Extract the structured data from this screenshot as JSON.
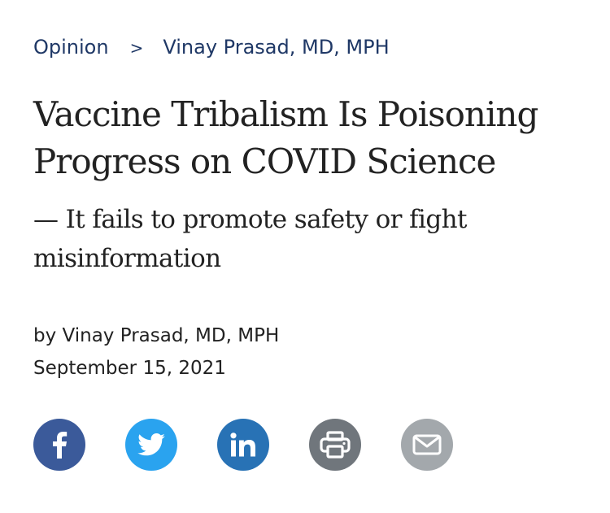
{
  "breadcrumb": {
    "section": "Opinion",
    "separator": ">",
    "author_link": "Vinay Prasad, MD, MPH"
  },
  "article": {
    "title": "Vaccine Tribalism Is Poisoning Progress on COVID Science",
    "subtitle": "— It fails to promote safety or fight misinformation",
    "byline": "by Vinay Prasad, MD, MPH",
    "date": "September 15, 2021"
  },
  "share": {
    "buttons": [
      {
        "icon": "facebook-icon",
        "color": "#3b5a9a"
      },
      {
        "icon": "twitter-icon",
        "color": "#2aa3ef"
      },
      {
        "icon": "linkedin-icon",
        "color": "#2872b5"
      },
      {
        "icon": "print-icon",
        "color": "#70767c"
      },
      {
        "icon": "email-icon",
        "color": "#a3a8ac"
      }
    ]
  }
}
